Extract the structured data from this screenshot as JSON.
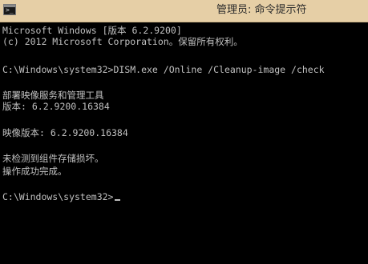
{
  "window": {
    "title": "管理员: 命令提示符",
    "icon": "cmd-console-icon"
  },
  "console": {
    "lines": [
      "Microsoft Windows [版本 6.2.9200]",
      "(c) 2012 Microsoft Corporation。保留所有权利。",
      "",
      "C:\\Windows\\system32>DISM.exe /Online /Cleanup-image /check",
      "",
      "部署映像服务和管理工具",
      "版本: 6.2.9200.16384",
      "",
      "映像版本: 6.2.9200.16384",
      "",
      "未检测到组件存储损坏。",
      "操作成功完成。",
      "",
      "C:\\Windows\\system32>"
    ],
    "text_color": "#c0c0c0",
    "background_color": "#000000"
  }
}
